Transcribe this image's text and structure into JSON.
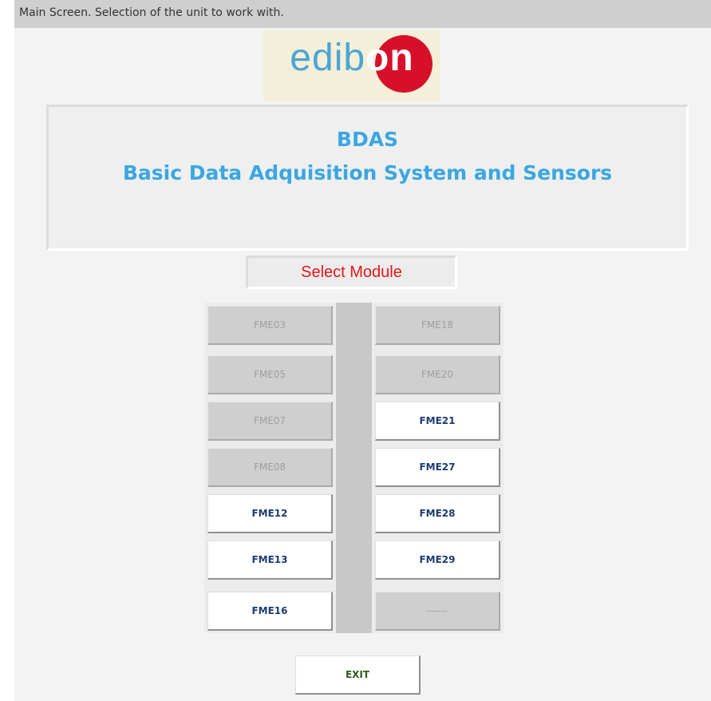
{
  "caption": "Main Screen. Selection of the unit to work with.",
  "logo": {
    "text_main": "edib",
    "text_tail": "on"
  },
  "title": {
    "line1": "BDAS",
    "line2": "Basic Data Adquisition System and Sensors"
  },
  "select_label": "Select Module",
  "modules": [
    {
      "label": "FME03",
      "enabled": false
    },
    {
      "label": "FME18",
      "enabled": false
    },
    {
      "label": "FME05",
      "enabled": false
    },
    {
      "label": "FME20",
      "enabled": false
    },
    {
      "label": "FME07",
      "enabled": false
    },
    {
      "label": "FME21",
      "enabled": true
    },
    {
      "label": "FME08",
      "enabled": false
    },
    {
      "label": "FME27",
      "enabled": true
    },
    {
      "label": "FME12",
      "enabled": true
    },
    {
      "label": "FME28",
      "enabled": true
    },
    {
      "label": "FME13",
      "enabled": true
    },
    {
      "label": "FME29",
      "enabled": true
    },
    {
      "label": "FME16",
      "enabled": true
    },
    {
      "label": "------",
      "enabled": false
    }
  ],
  "exit_label": "EXIT",
  "colors": {
    "title": "#3aa7e0",
    "select_label": "#e01818",
    "logo_red": "#d6102a",
    "logo_blue": "#4aa5d4",
    "enabled_text": "#1d3b73",
    "disabled_text": "#9e9e9e",
    "exit_text": "#2f5f1f"
  }
}
